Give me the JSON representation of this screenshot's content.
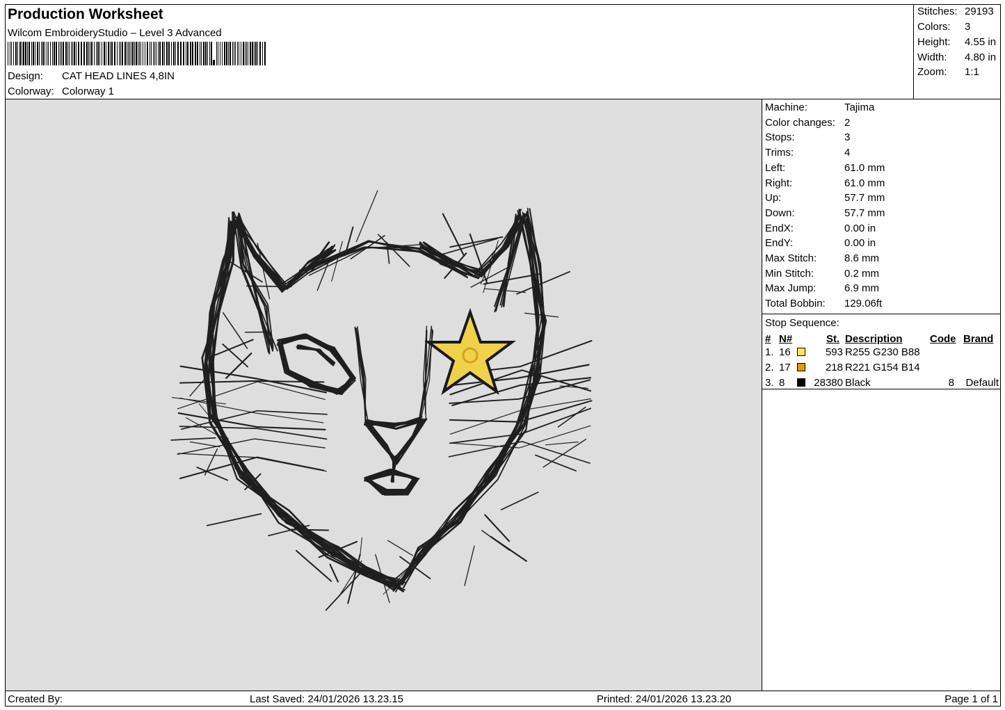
{
  "header": {
    "title": "Production Worksheet",
    "software": "Wilcom EmbroideryStudio – Level 3 Advanced",
    "design_label": "Design:",
    "design_value": "CAT HEAD LINES 4,8IN",
    "colorway_label": "Colorway:",
    "colorway_value": "Colorway 1"
  },
  "stats": [
    {
      "label": "Stitches:",
      "value": "29193"
    },
    {
      "label": "Colors:",
      "value": "3"
    },
    {
      "label": "Height:",
      "value": "4.55 in"
    },
    {
      "label": "Width:",
      "value": "4.80 in"
    },
    {
      "label": "Zoom:",
      "value": "1:1"
    }
  ],
  "machine_info": [
    {
      "label": "Machine:",
      "value": "Tajima"
    },
    {
      "label": "Color changes:",
      "value": "2"
    },
    {
      "label": "Stops:",
      "value": "3"
    },
    {
      "label": "Trims:",
      "value": "4"
    },
    {
      "label": "Left:",
      "value": "61.0 mm"
    },
    {
      "label": "Right:",
      "value": "61.0 mm"
    },
    {
      "label": "Up:",
      "value": "57.7 mm"
    },
    {
      "label": "Down:",
      "value": "57.7 mm"
    },
    {
      "label": "EndX:",
      "value": "0.00 in"
    },
    {
      "label": "EndY:",
      "value": "0.00 in"
    },
    {
      "label": "Max Stitch:",
      "value": "8.6 mm"
    },
    {
      "label": "Min Stitch:",
      "value": "0.2 mm"
    },
    {
      "label": "Max Jump:",
      "value": "6.9 mm"
    },
    {
      "label": "Total Bobbin:",
      "value": "129.06ft"
    }
  ],
  "stop_sequence": {
    "title": "Stop Sequence:",
    "columns": [
      "#",
      "N#",
      "St.",
      "Description",
      "Code",
      "Brand"
    ],
    "rows": [
      {
        "idx": "1.",
        "n": "16",
        "color": "#ffe658",
        "st": "593",
        "desc": "R255 G230 B88",
        "code": "",
        "brand": ""
      },
      {
        "idx": "2.",
        "n": "17",
        "color": "#dd9a0e",
        "st": "218",
        "desc": "R221 G154 B14",
        "code": "",
        "brand": ""
      },
      {
        "idx": "3.",
        "n": "8",
        "color": "#000000",
        "st": "28380",
        "desc": "Black",
        "code": "8",
        "brand": "Default"
      }
    ]
  },
  "footer": {
    "created_by": "Created By:",
    "last_saved": "Last Saved: 24/01/2026 13.23.15",
    "printed": "Printed: 24/01/2026 13.23.20",
    "page": "Page 1 of 1"
  },
  "colors": {
    "design_bg": "#dedede",
    "thread_black": "#1a1a1a",
    "thread_yellow": "#ffe658",
    "thread_gold": "#dd9a0e"
  }
}
